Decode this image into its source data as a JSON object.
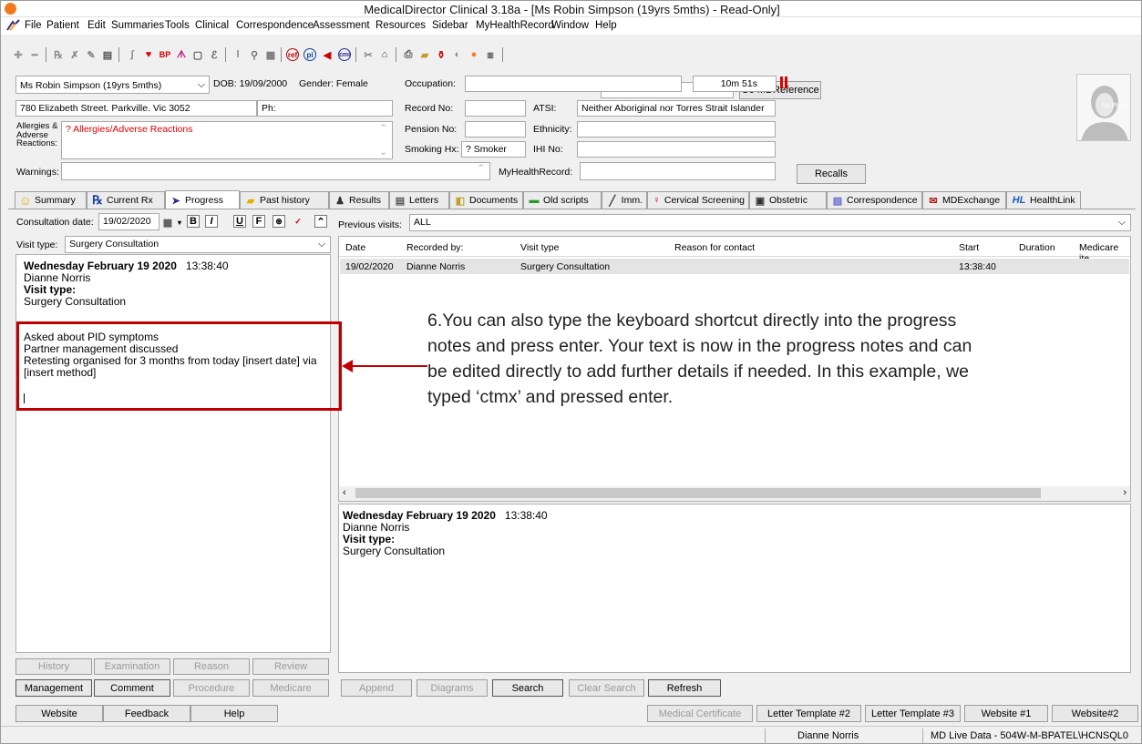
{
  "window": {
    "title": "MedicalDirector Clinical 3.18a - [Ms Robin Simpson (19yrs 5mths) - Read-Only]"
  },
  "menu": [
    "File",
    "Patient",
    "Edit",
    "Summaries",
    "Tools",
    "Clinical",
    "Correspondence",
    "Assessment",
    "Resources",
    "Sidebar",
    "MyHealthRecord",
    "Window",
    "Help"
  ],
  "toolbar": {
    "search_value": "",
    "go_label": "Go MDReference"
  },
  "patient": {
    "name": "Ms Robin Simpson (19yrs 5mths)",
    "dob_label": "DOB: 19/09/2000",
    "gender_label": "Gender: Female",
    "occupation_label": "Occupation:",
    "occupation": "",
    "timer": "10m 51s",
    "address": "780 Elizabeth Street. Parkville. Vic  3052",
    "ph_label": "Ph:",
    "record_no_label": "Record No:",
    "atsi_label": "ATSI:",
    "atsi": "Neither Aboriginal nor Torres Strait Islander",
    "allergies_label": "Allergies & Adverse Reactions:",
    "allergies": "? Allergies/Adverse Reactions",
    "pension_label": "Pension No:",
    "ethnicity_label": "Ethnicity:",
    "smoking_label": "Smoking Hx:",
    "smoking": "? Smoker",
    "ihi_label": "IHI No:",
    "warnings_label": "Warnings:",
    "myhr_label": "MyHealthRecord:",
    "recalls_label": "Recalls",
    "photo_label": "No Photo"
  },
  "tabs": [
    {
      "label": "Summary",
      "icon": "smiley-icon"
    },
    {
      "label": "Current Rx",
      "icon": "rx-icon"
    },
    {
      "label": "Progress",
      "icon": "progress-icon"
    },
    {
      "label": "Past history",
      "icon": "folder-icon"
    },
    {
      "label": "Results",
      "icon": "results-icon"
    },
    {
      "label": "Letters",
      "icon": "letters-icon"
    },
    {
      "label": "Documents",
      "icon": "documents-icon"
    },
    {
      "label": "Old scripts",
      "icon": "old-scripts-icon"
    },
    {
      "label": "Imm.",
      "icon": "syringe-icon"
    },
    {
      "label": "Cervical Screening",
      "icon": "female-icon"
    },
    {
      "label": "Obstetric",
      "icon": "obstetric-icon"
    },
    {
      "label": "Correspondence",
      "icon": "correspondence-icon"
    },
    {
      "label": "MDExchange",
      "icon": "mdexchange-icon"
    },
    {
      "label": "HealthLink",
      "icon": "healthlink-icon"
    }
  ],
  "consult": {
    "date_label": "Consultation date:",
    "date": "19/02/2020",
    "visit_type_label": "Visit type:",
    "visit_type": "Surgery Consultation",
    "prev_label": "Previous visits:",
    "prev_filter": "ALL"
  },
  "note": {
    "header_date": "Wednesday February 19 2020",
    "header_time": "13:38:40",
    "doctor": "Dianne Norris",
    "vt_label": "Visit type:",
    "vt": "Surgery Consultation",
    "line1": "Asked about PID symptoms",
    "line2": "Partner management discussed",
    "line3": "Retesting organised for 3 months from today [insert date] via [insert method]"
  },
  "grid": {
    "columns": [
      "Date",
      "Recorded by:",
      "Visit type",
      "Reason for contact",
      "Start",
      "Duration",
      "Medicare ite"
    ],
    "row": [
      "19/02/2020",
      "Dianne Norris",
      "Surgery Consultation",
      "",
      "13:38:40",
      "",
      ""
    ]
  },
  "preview": {
    "header_date": "Wednesday February 19 2020",
    "header_time": "13:38:40",
    "doctor": "Dianne Norris",
    "vt_label": "Visit type:",
    "vt": "Surgery Consultation"
  },
  "left_buttons": {
    "history": "History",
    "examination": "Examination",
    "reason": "Reason",
    "review": "Review",
    "management": "Management",
    "comment": "Comment",
    "procedure": "Procedure",
    "medicare": "Medicare"
  },
  "right_buttons": {
    "append": "Append",
    "diagrams": "Diagrams",
    "search": "Search",
    "clear_search": "Clear Search",
    "refresh": "Refresh"
  },
  "bottom_buttons": {
    "website": "Website",
    "feedback": "Feedback",
    "help": "Help",
    "med_cert": "Medical Certificate",
    "lt2": "Letter Template #2",
    "lt3": "Letter Template #3",
    "ws1": "Website #1",
    "ws2": "Website#2"
  },
  "status": {
    "user": "Dianne Norris",
    "db": "MD Live Data - 504W-M-BPATEL\\HCNSQL0"
  },
  "annotation": {
    "text": "6.You can also type the keyboard shortcut directly into the progress notes and press enter. Your text is now in the progress notes and can be edited directly to add further details if needed. In this example, we typed ‘ctmx’ and pressed enter."
  },
  "colors": {
    "highlight": "#c00000",
    "allergy_text": "#e00000"
  }
}
